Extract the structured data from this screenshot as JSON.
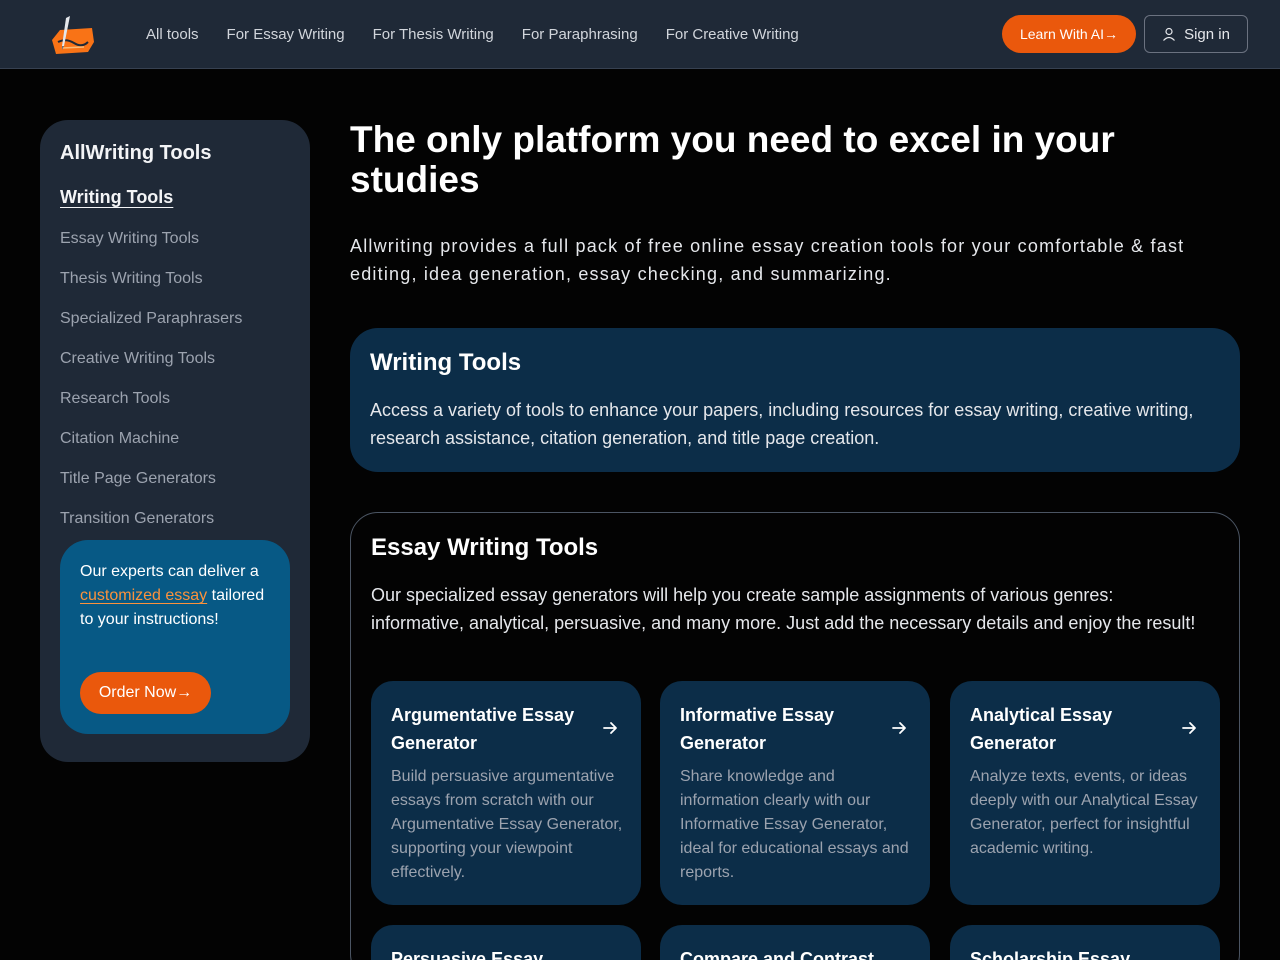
{
  "header": {
    "logo_icon": "pen-paper-logo-icon",
    "nav": [
      "All tools",
      "For Essay Writing",
      "For Thesis Writing",
      "For Paraphrasing",
      "For Creative Writing"
    ],
    "learn_button": "Learn With AI",
    "signin_button": "Sign in",
    "accent": "#ea580c"
  },
  "sidebar": {
    "title": "AllWriting Tools",
    "active": "Writing Tools",
    "items": [
      "Essay Writing Tools",
      "Thesis Writing Tools",
      "Specialized Paraphrasers",
      "Creative Writing Tools",
      "Research Tools",
      "Citation Machine",
      "Title Page Generators",
      "Transition Generators"
    ],
    "promo": {
      "text_before": "Our experts can deliver a",
      "link": "customized essay",
      "text_after": "tailored to your instructions!",
      "button": "Order Now"
    }
  },
  "main": {
    "title": "The only platform you need to excel in your studies",
    "subtitle": "Allwriting provides a full pack of free online essay creation tools for your comfortable & fast editing, idea generation, essay checking, and summarizing.",
    "writing_tools": {
      "title": "Writing Tools",
      "description": "Access a variety of tools to enhance your papers, including resources for essay writing, creative writing, research assistance, citation generation, and title page creation."
    },
    "essay_tools": {
      "title": "Essay Writing Tools",
      "description": "Our specialized essay generators will help you create sample assignments of various genres: informative, analytical, persuasive, and many more. Just add the necessary details and enjoy the result!",
      "cards": [
        {
          "title": "Argumentative Essay Generator",
          "description": "Build persuasive argumentative essays from scratch with our Argumentative Essay Generator, supporting your viewpoint effectively."
        },
        {
          "title": "Informative Essay Generator",
          "description": "Share knowledge and information clearly with our Informative Essay Generator, ideal for educational essays and reports."
        },
        {
          "title": "Analytical Essay Generator",
          "description": "Analyze texts, events, or ideas deeply with our Analytical Essay Generator, perfect for insightful academic writing."
        },
        {
          "title": "Persuasive Essay",
          "description": ""
        },
        {
          "title": "Compare and Contrast",
          "description": ""
        },
        {
          "title": "Scholarship Essay",
          "description": ""
        }
      ]
    }
  }
}
